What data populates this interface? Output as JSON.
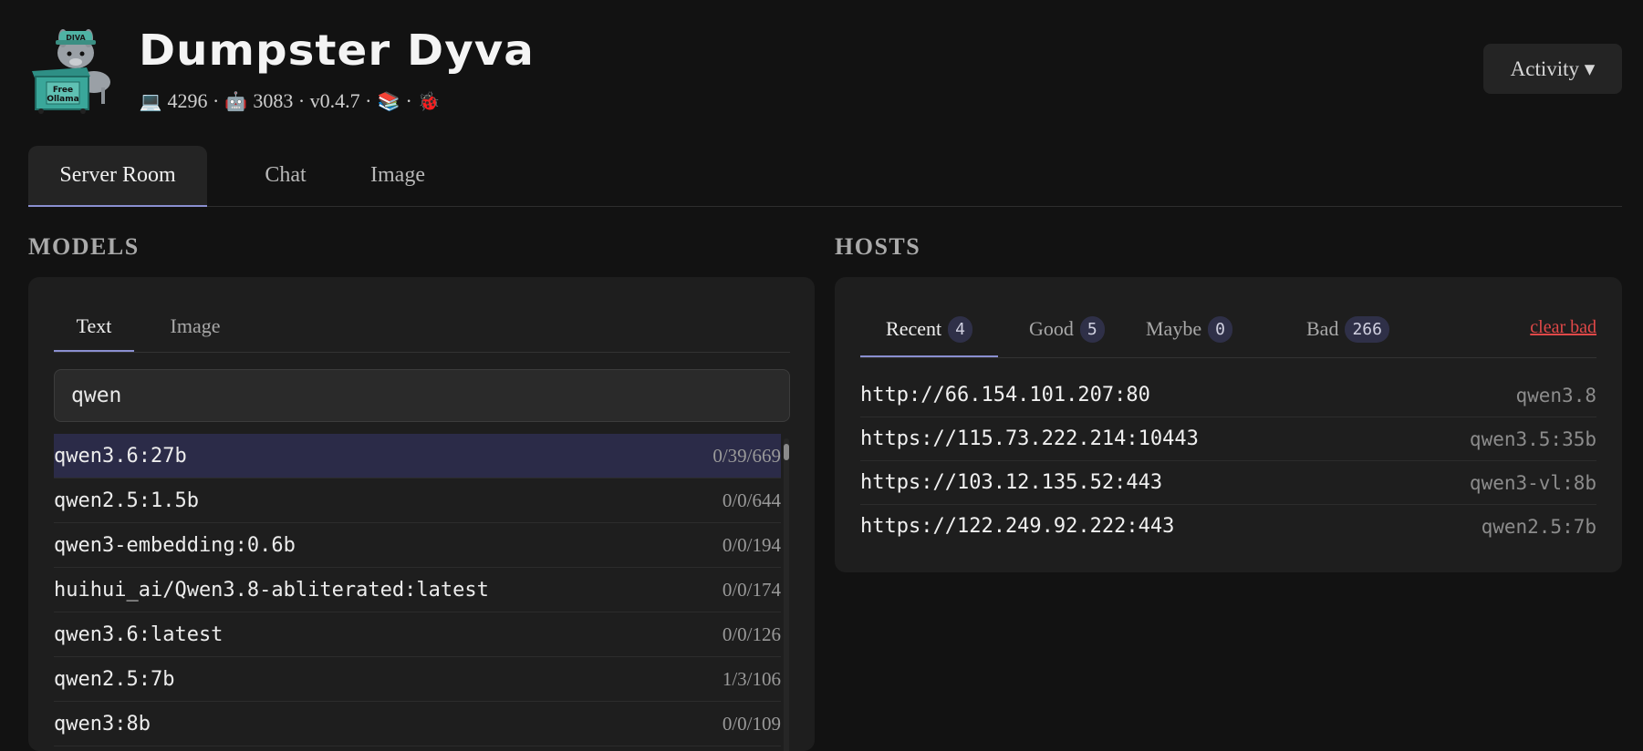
{
  "header": {
    "title": "Dumpster Dyva",
    "logo_text": [
      "DIVA",
      "Free",
      "Ollama"
    ],
    "stats": {
      "laptop_count": "4296",
      "bot_count": "3083",
      "version": "v0.4.7",
      "separator": "·"
    },
    "activity_label": "Activity ▾"
  },
  "main_tabs": [
    {
      "label": "Server Room"
    },
    {
      "label": "Chat"
    },
    {
      "label": "Image"
    }
  ],
  "models": {
    "heading": "MODELS",
    "tabs": [
      {
        "label": "Text"
      },
      {
        "label": "Image"
      }
    ],
    "search_value": "qwen",
    "rows": [
      {
        "name": "qwen3.6:27b",
        "count": "0/39/669"
      },
      {
        "name": "qwen2.5:1.5b",
        "count": "0/0/644"
      },
      {
        "name": "qwen3-embedding:0.6b",
        "count": "0/0/194"
      },
      {
        "name": "huihui_ai/Qwen3.8-abliterated:latest",
        "count": "0/0/174"
      },
      {
        "name": "qwen3.6:latest",
        "count": "0/0/126"
      },
      {
        "name": "qwen2.5:7b",
        "count": "1/3/106"
      },
      {
        "name": "qwen3:8b",
        "count": "0/0/109"
      }
    ]
  },
  "hosts": {
    "heading": "HOSTS",
    "tabs": [
      {
        "label": "Recent",
        "count": "4"
      },
      {
        "label": "Good",
        "count": "5"
      },
      {
        "label": "Maybe",
        "count": "0"
      },
      {
        "label": "Bad",
        "count": "266"
      }
    ],
    "clear_label": "clear bad",
    "rows": [
      {
        "url": "http://66.154.101.207:80",
        "model": "qwen3.8"
      },
      {
        "url": "https://115.73.222.214:10443",
        "model": "qwen3.5:35b"
      },
      {
        "url": "https://103.12.135.52:443",
        "model": "qwen3-vl:8b"
      },
      {
        "url": "https://122.249.92.222:443",
        "model": "qwen2.5:7b"
      }
    ]
  },
  "colors": {
    "accent": "#8a8fd0",
    "danger": "#e04848",
    "selected_row": "#2b2b48"
  },
  "icons": [
    "laptop-icon",
    "robot-icon",
    "books-icon",
    "ladybug-icon"
  ]
}
